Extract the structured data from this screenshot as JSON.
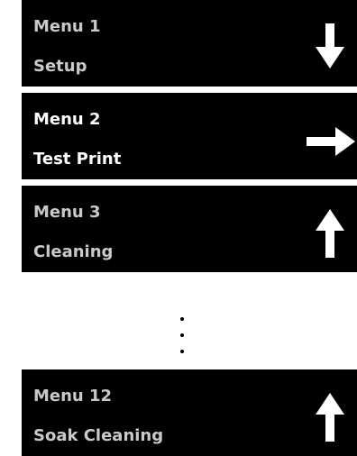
{
  "menus": [
    {
      "number": "Menu 1",
      "name": "Setup",
      "arrow": "arrow-down-icon",
      "number_color": "#c9c9c9",
      "name_color": "#c9c9c9"
    },
    {
      "number": "Menu 2",
      "name": "Test Print",
      "arrow": "arrow-right-icon",
      "number_color": "#ffffff",
      "name_color": "#ffffff"
    },
    {
      "number": "Menu 3",
      "name": "Cleaning",
      "arrow": "arrow-up-icon",
      "number_color": "#c9c9c9",
      "name_color": "#c9c9c9"
    },
    {
      "number": "Menu 12",
      "name": "Soak Cleaning",
      "arrow": "arrow-up-icon",
      "number_color": "#c9c9c9",
      "name_color": "#c9c9c9"
    }
  ],
  "colors": {
    "panel_background": "#000000",
    "arrow": "#ffffff",
    "ellipsis_dots": "#000000",
    "page_background": "#ffffff"
  },
  "ellipsis": "⋮"
}
